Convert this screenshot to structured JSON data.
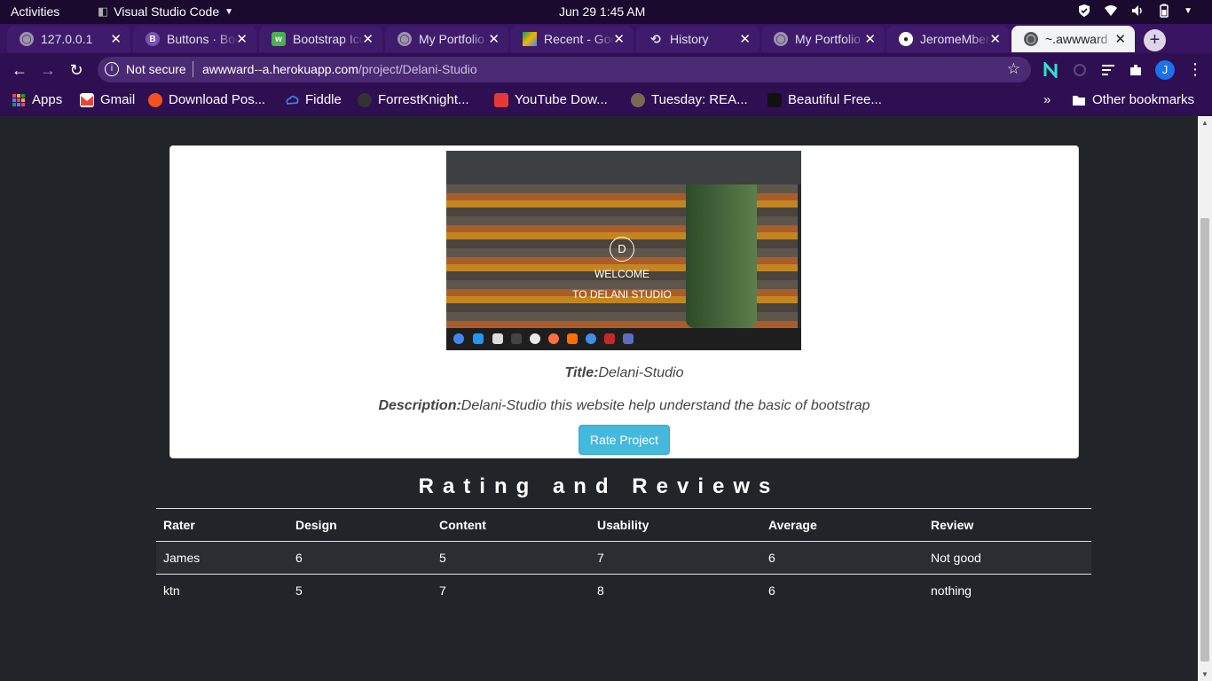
{
  "os": {
    "activities": "Activities",
    "app_name": "Visual Studio Code",
    "clock": "Jun 29   1:45 AM"
  },
  "browser": {
    "tabs": [
      {
        "label": "127.0.0.1",
        "icon": "globe-icon"
      },
      {
        "label": "Buttons · Bootstrap",
        "icon": "bootstrap-icon"
      },
      {
        "label": "Bootstrap Icons",
        "icon": "w3-icon"
      },
      {
        "label": "My Portfolio",
        "icon": "globe-icon"
      },
      {
        "label": "Recent - Google Drive",
        "icon": "drive-icon"
      },
      {
        "label": "History",
        "icon": "history-icon"
      },
      {
        "label": "My Portfolio",
        "icon": "globe-icon"
      },
      {
        "label": "JeromeMberia",
        "icon": "github-icon"
      },
      {
        "label": "~.awwward",
        "icon": "globe-icon"
      }
    ],
    "security": "Not secure",
    "url_host": "awwward--a.herokuapp.com",
    "url_path": "/project/Delani-Studio",
    "profile_initial": "J",
    "bookmarks": [
      {
        "label": "Apps",
        "icon": "apps-icon",
        "color": "#e8453c"
      },
      {
        "label": "Gmail",
        "icon": "gmail-icon",
        "color": "#ea4335"
      },
      {
        "label": "Download Pos...",
        "icon": "download-icon",
        "color": "#f4511e"
      },
      {
        "label": "Fiddle",
        "icon": "fiddle-icon",
        "color": "#4285f4"
      },
      {
        "label": "ForrestKnight...",
        "icon": "github-icon",
        "color": "#333333"
      },
      {
        "label": "YouTube Dow...",
        "icon": "youtube-icon",
        "color": "#e53935"
      },
      {
        "label": "Tuesday: REA...",
        "icon": "pin-icon",
        "color": "#7a6a55"
      },
      {
        "label": "Beautiful Free...",
        "icon": "bag-icon",
        "color": "#222222"
      }
    ],
    "other_bookmarks": "Other bookmarks",
    "overflow": "»"
  },
  "project": {
    "screenshot_logo": "D",
    "screenshot_line1": "WELCOME",
    "screenshot_line2": "TO DELANI STUDIO",
    "title_label": "Title:",
    "title_value": "Delani-Studio",
    "description_label": "Description:",
    "description_value": "Delani-Studio this website help understand the basic of bootstrap",
    "rate_button": "Rate Project"
  },
  "reviews": {
    "heading": "Rating and Reviews",
    "columns": [
      "Rater",
      "Design",
      "Content",
      "Usability",
      "Average",
      "Review"
    ],
    "rows": [
      [
        "James",
        "6",
        "5",
        "7",
        "6",
        "Not good"
      ],
      [
        "ktn",
        "5",
        "7",
        "8",
        "6",
        "nothing"
      ]
    ]
  }
}
